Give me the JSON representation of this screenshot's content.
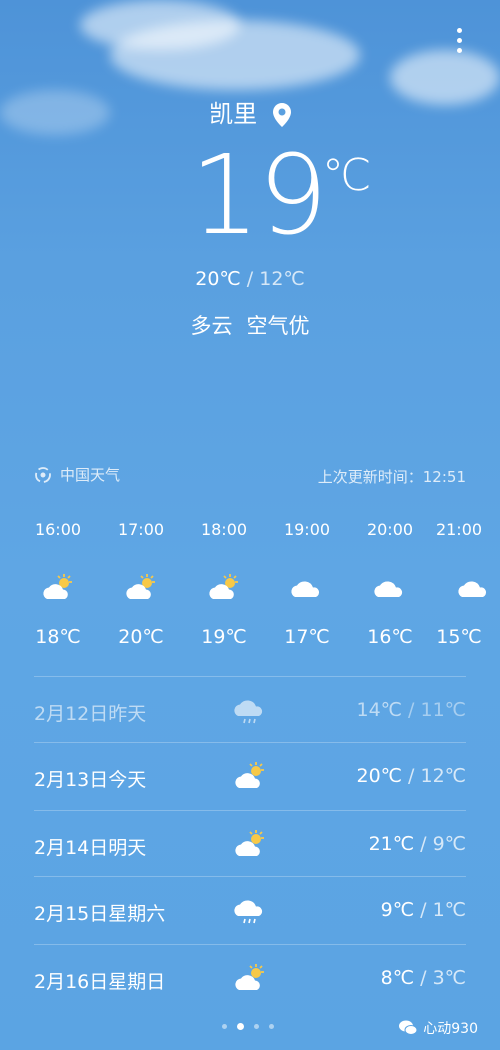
{
  "location": {
    "city": "凯里"
  },
  "current": {
    "temp": "19",
    "unit": "℃",
    "high": "20℃",
    "low": "12℃",
    "condition": "多云",
    "air": "空气优"
  },
  "source": {
    "name": "中国天气",
    "updated_label": "上次更新时间：",
    "updated_time": "12:51"
  },
  "hourly": [
    {
      "time": "16:00",
      "icon": "partly-sunny-icon",
      "temp": "18℃"
    },
    {
      "time": "17:00",
      "icon": "partly-sunny-icon",
      "temp": "20℃"
    },
    {
      "time": "18:00",
      "icon": "partly-sunny-icon",
      "temp": "19℃"
    },
    {
      "time": "19:00",
      "icon": "cloudy-icon",
      "temp": "17℃"
    },
    {
      "time": "20:00",
      "icon": "cloudy-icon",
      "temp": "16℃"
    },
    {
      "time": "21:00",
      "icon": "cloudy-icon",
      "temp": "15℃"
    }
  ],
  "daily": [
    {
      "label": "2月12日昨天",
      "icon": "light-rain-icon",
      "high": "14℃",
      "low": "11℃"
    },
    {
      "label": "2月13日今天",
      "icon": "partly-sunny-icon",
      "high": "20℃",
      "low": "12℃"
    },
    {
      "label": "2月14日明天",
      "icon": "partly-sunny-icon",
      "high": "21℃",
      "low": "9℃"
    },
    {
      "label": "2月15日星期六",
      "icon": "light-rain-icon",
      "high": "9℃",
      "low": "1℃"
    },
    {
      "label": "2月16日星期日",
      "icon": "partly-sunny-icon",
      "high": "8℃",
      "low": "3℃"
    }
  ],
  "watermark": {
    "text": "心动930"
  },
  "colors": {
    "sun": "#f7c948",
    "cloud": "#ffffff"
  }
}
